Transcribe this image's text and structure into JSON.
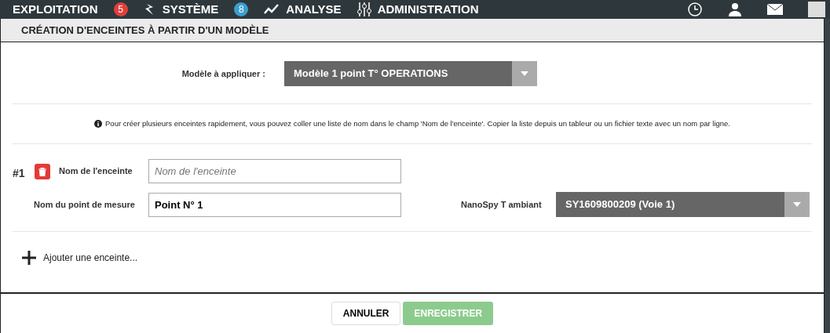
{
  "nav": {
    "items": [
      {
        "label": "EXPLOITATION",
        "badge": "5",
        "color": "#e0403c"
      },
      {
        "label": "SYSTÈME",
        "badge": "8",
        "color": "#3b9fd1"
      },
      {
        "label": "ANALYSE"
      },
      {
        "label": "ADMINISTRATION"
      }
    ]
  },
  "dialog": {
    "title": "CRÉATION D'ENCEINTES À PARTIR D'UN MODÈLE",
    "template": {
      "label": "Modèle à appliquer :",
      "value": "Modèle 1 point T° OPERATIONS"
    },
    "info": "Pour créer plusieurs enceintes rapidement, vous pouvez coller une liste de nom dans le champ 'Nom de l'enceinte'. Copier la liste depuis un tableur ou un fichier texte avec un nom par ligne.",
    "enclosures": [
      {
        "number": "#1",
        "name_label": "Nom de l'enceinte",
        "name_placeholder": "Nom de l'enceinte",
        "point_label": "Nom du point de mesure",
        "point_value": "Point N° 1",
        "sensor_label": "NanoSpy T ambiant",
        "sensor_value": "SY1609800209 (Voie 1)"
      }
    ],
    "add_link": "Ajouter une enceinte...",
    "buttons": [
      {
        "label": "ANNULER",
        "kind": "secondary",
        "disabled": false
      },
      {
        "label": "ENREGISTRER",
        "kind": "primary",
        "disabled": true
      }
    ]
  }
}
